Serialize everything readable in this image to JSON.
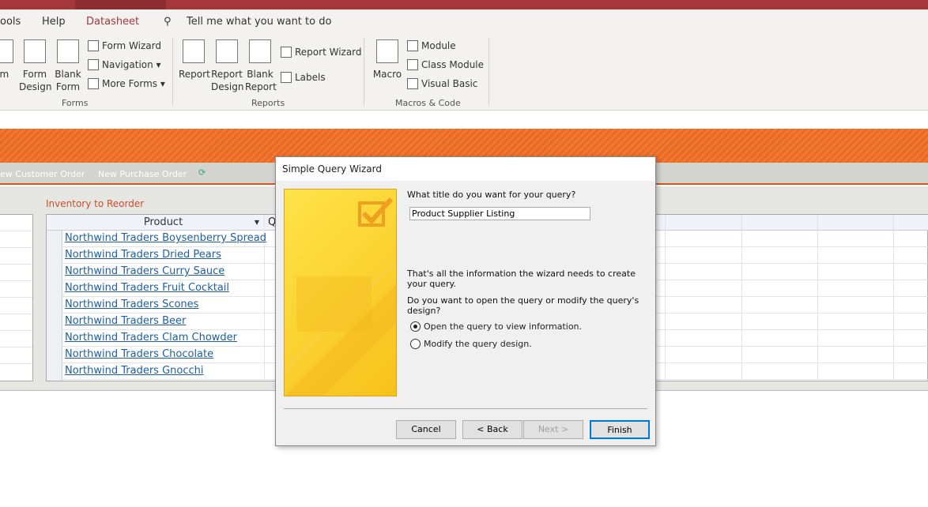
{
  "tabs": [
    "ools",
    "Help",
    "Datasheet"
  ],
  "tell_me": "Tell me what you want to do",
  "ribbon": {
    "forms": {
      "big": [
        {
          "label": "rm"
        },
        {
          "label": "Form Design"
        },
        {
          "label": "Blank Form"
        }
      ],
      "small": [
        "Form Wizard",
        "Navigation ▾",
        "More Forms ▾"
      ],
      "group": "Forms"
    },
    "reports": {
      "big": [
        {
          "label": "Report"
        },
        {
          "label": "Report Design"
        },
        {
          "label": "Blank Report"
        }
      ],
      "small": [
        "Report Wizard",
        "Labels"
      ],
      "group": "Reports"
    },
    "macros": {
      "big": [
        {
          "label": "Macro"
        }
      ],
      "small": [
        "Module",
        "Class Module",
        "Visual Basic"
      ],
      "group": "Macros & Code"
    }
  },
  "nav": [
    "ew Customer Order",
    "New Purchase Order"
  ],
  "inventory_label": "Inventory to Reorder",
  "grid": {
    "header": "Product",
    "header2": "Q",
    "rows": [
      "Northwind Traders Boysenberry Spread",
      "Northwind Traders Dried Pears",
      "Northwind Traders Curry Sauce",
      "Northwind Traders Fruit Cocktail",
      "Northwind Traders Scones",
      "Northwind Traders Beer",
      "Northwind Traders Clam Chowder",
      "Northwind Traders Chocolate",
      "Northwind Traders Gnocchi"
    ]
  },
  "dialog": {
    "title": "Simple Query Wizard",
    "question": "What title do you want for your query?",
    "query_title": "Product Supplier Listing",
    "info": "That's all the information the wizard needs to create your query.",
    "question2": "Do you want to open the query or modify the query's design?",
    "options": [
      {
        "label": "Open the query to view information.",
        "selected": true
      },
      {
        "label": "Modify the query design.",
        "selected": false
      }
    ],
    "buttons": {
      "cancel": "Cancel",
      "back": "< Back",
      "next": "Next >",
      "finish": "Finish"
    }
  },
  "colors": {
    "title_bar": "#a4373a",
    "accent_orange": "#ea6a23",
    "link": "#1f5fa0",
    "default_button": "#0078d7"
  }
}
